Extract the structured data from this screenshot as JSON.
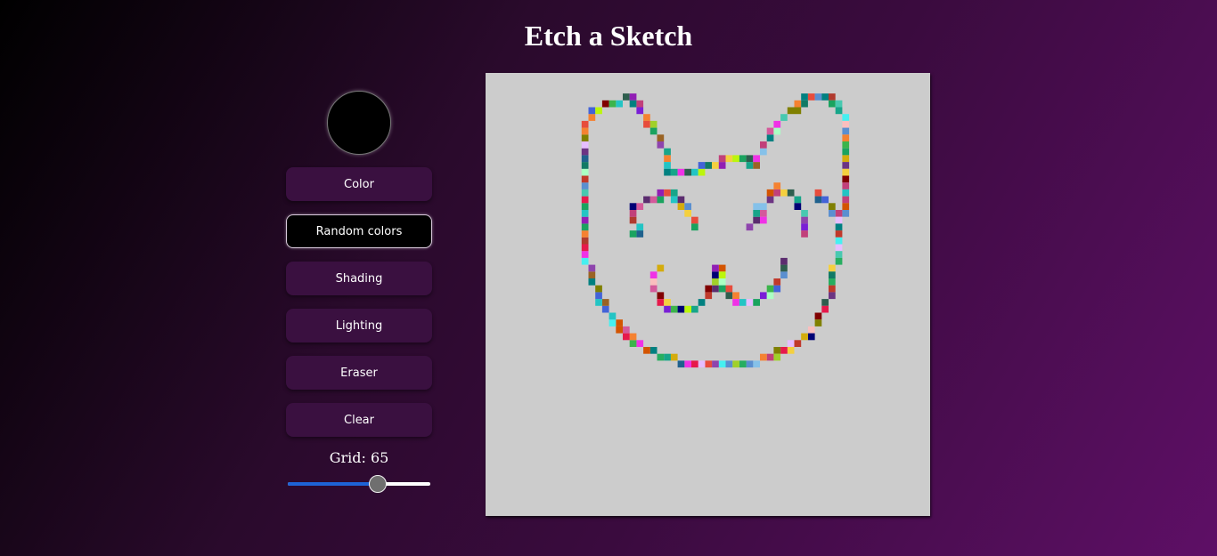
{
  "title": "Etch a Sketch",
  "controls": {
    "color_value": "#000000",
    "buttons": [
      {
        "id": "color",
        "label": "Color"
      },
      {
        "id": "random",
        "label": "Random colors",
        "active": true
      },
      {
        "id": "shading",
        "label": "Shading"
      },
      {
        "id": "lighting",
        "label": "Lighting"
      },
      {
        "id": "eraser",
        "label": "Eraser"
      },
      {
        "id": "clear",
        "label": "Clear"
      }
    ],
    "grid_label": "Grid: 65",
    "grid_size": 65,
    "grid_min": 1,
    "grid_max": 100
  },
  "board": {
    "background": "#cccccc",
    "drawing_mode": "random colors",
    "palette": [
      "#e6194b",
      "#3cb44b",
      "#4363d8",
      "#f58231",
      "#911eb4",
      "#46f0f0",
      "#f032e6",
      "#bcf60c",
      "#fabebe",
      "#008080",
      "#e6beff",
      "#9a6324",
      "#800000",
      "#aaffc3",
      "#808000",
      "#000075",
      "#1aa35f",
      "#c1407a",
      "#5a8fd0",
      "#23c4c4",
      "#7a1fd6",
      "#d45a9b",
      "#2e5e4e",
      "#a0d02a",
      "#b03a2e",
      "#6c3483",
      "#17a589",
      "#d4ac0d",
      "#1f618d",
      "#c0392b",
      "#48c9b0",
      "#8e44ad",
      "#2874a6",
      "#d35400",
      "#27ae60",
      "#e74c3c",
      "#5b2c6f",
      "#117a65",
      "#f4d03f",
      "#85c1e9"
    ]
  }
}
